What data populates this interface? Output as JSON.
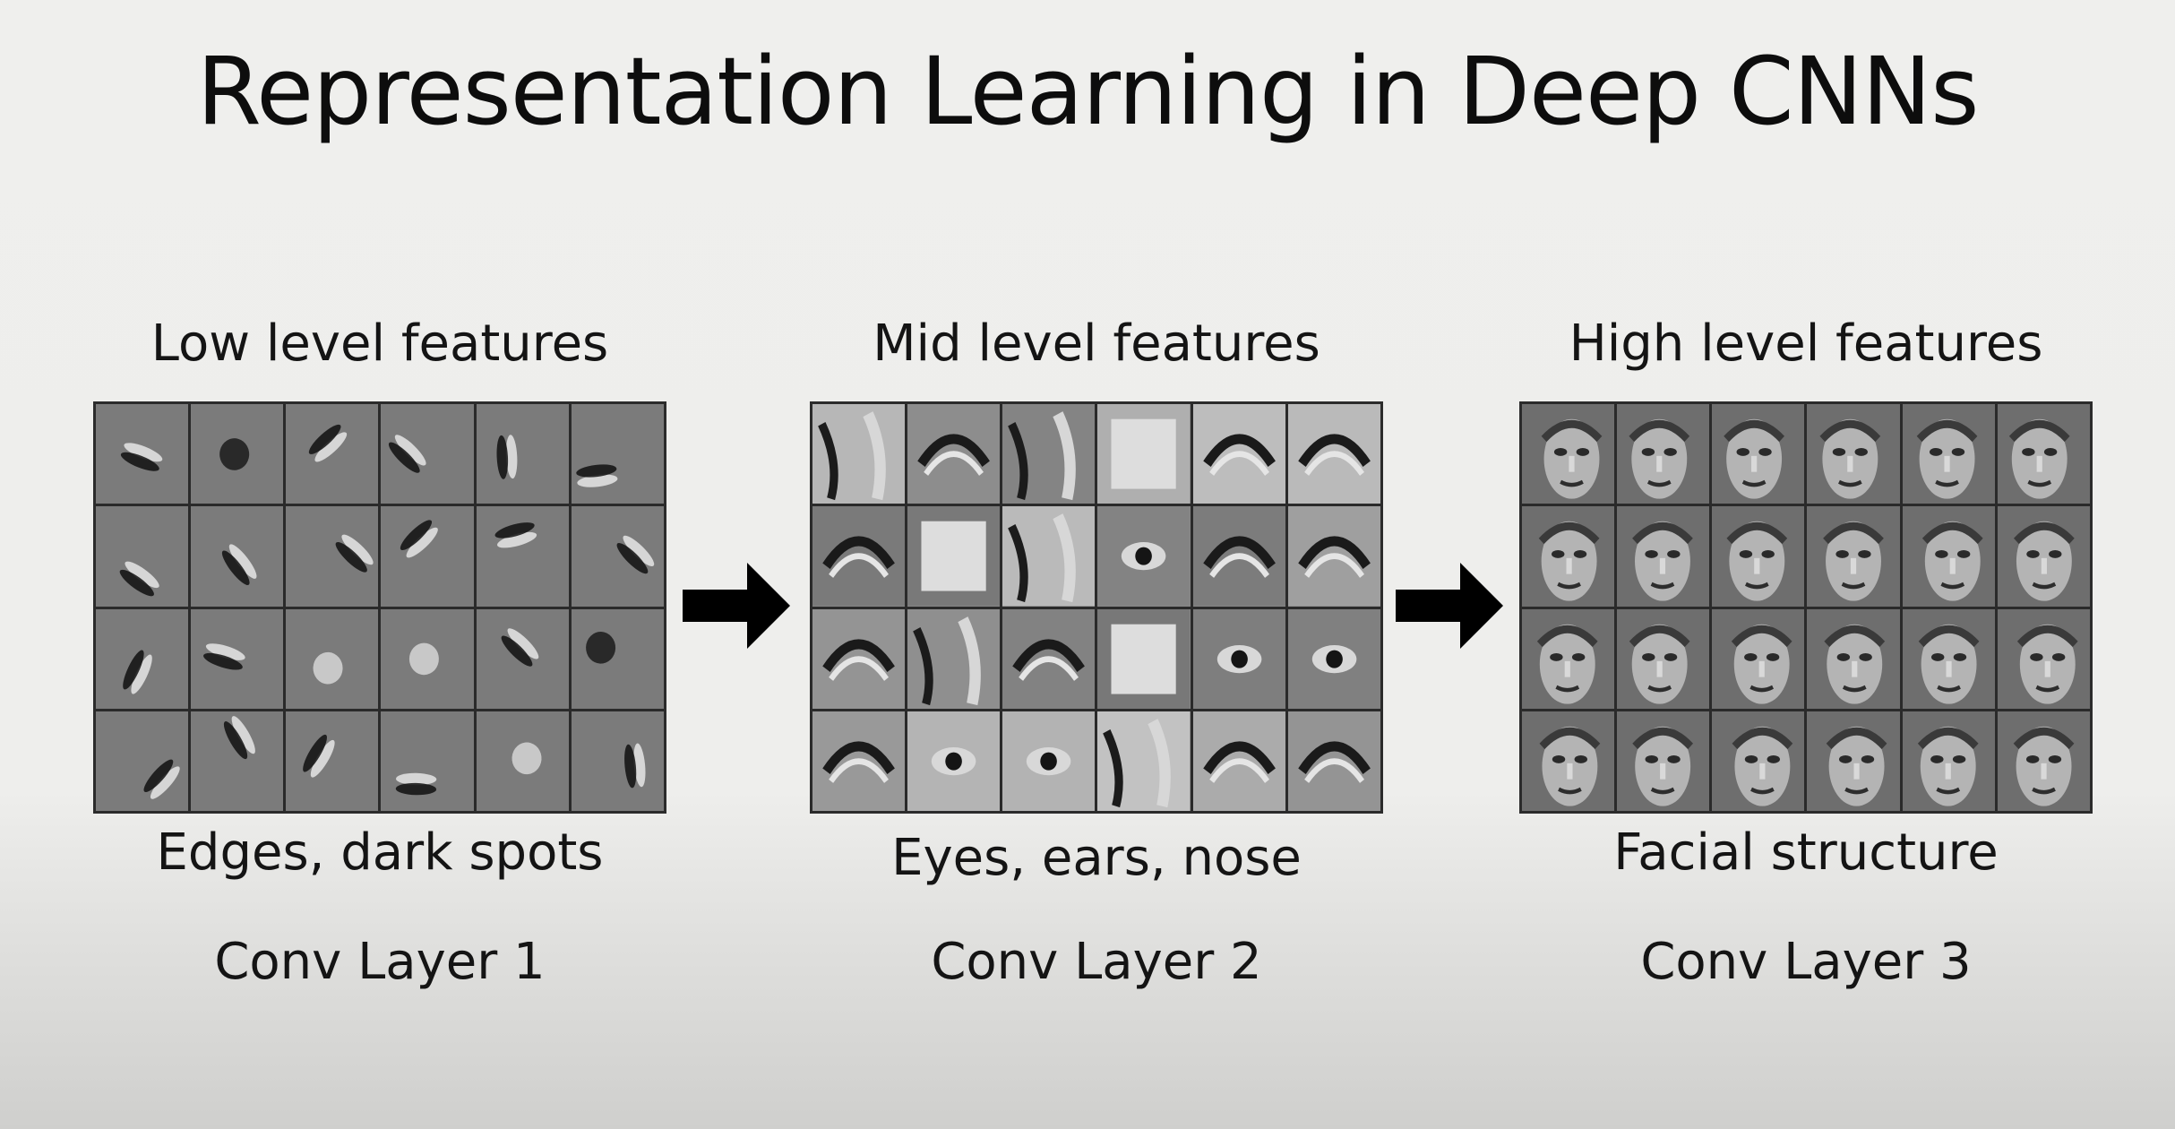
{
  "slide": {
    "title": "Representation Learning in Deep CNNs"
  },
  "stages": [
    {
      "heading": "Low level features",
      "caption": "Edges, dark spots",
      "layer": "Conv Layer 1",
      "grid_image": "edge-filter-visualizations"
    },
    {
      "heading": "Mid level features",
      "caption": "Eyes, ears, nose",
      "layer": "Conv Layer 2",
      "grid_image": "facial-part-visualizations"
    },
    {
      "heading": "High level features",
      "caption": "Facial structure",
      "layer": "Conv Layer 3",
      "grid_image": "face-visualizations"
    }
  ],
  "arrows": [
    {
      "icon": "right-arrow-icon"
    },
    {
      "icon": "right-arrow-icon"
    }
  ],
  "colors": {
    "background": "#eeeeec",
    "text": "#111111",
    "arrow": "#000000",
    "grid_border": "#2b2b2b"
  }
}
